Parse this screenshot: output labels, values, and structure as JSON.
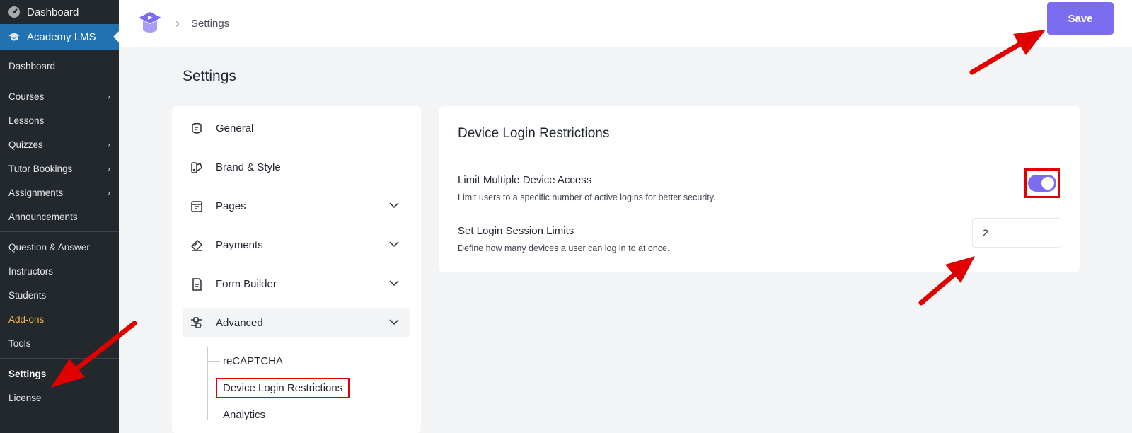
{
  "wp_sidebar": {
    "top_item": "Dashboard",
    "active_plugin": "Academy LMS",
    "items": [
      {
        "label": "Dashboard",
        "chevron": false
      },
      {
        "label": "Courses",
        "chevron": true
      },
      {
        "label": "Lessons",
        "chevron": false
      },
      {
        "label": "Quizzes",
        "chevron": true
      },
      {
        "label": "Tutor Bookings",
        "chevron": true
      },
      {
        "label": "Assignments",
        "chevron": true
      },
      {
        "label": "Announcements",
        "chevron": false
      },
      {
        "label": "Question & Answer",
        "chevron": false
      },
      {
        "label": "Instructors",
        "chevron": false
      },
      {
        "label": "Students",
        "chevron": false
      },
      {
        "label": "Add-ons",
        "chevron": false
      },
      {
        "label": "Tools",
        "chevron": false
      },
      {
        "label": "Settings",
        "chevron": false
      },
      {
        "label": "License",
        "chevron": false
      }
    ]
  },
  "header": {
    "breadcrumb": "Settings",
    "save_label": "Save"
  },
  "page_title": "Settings",
  "settings_menu": {
    "items": [
      {
        "label": "General",
        "icon": "general-icon"
      },
      {
        "label": "Brand & Style",
        "icon": "brand-style-icon"
      },
      {
        "label": "Pages",
        "icon": "pages-icon"
      },
      {
        "label": "Payments",
        "icon": "payments-icon"
      },
      {
        "label": "Form Builder",
        "icon": "form-builder-icon"
      },
      {
        "label": "Advanced",
        "icon": "advanced-icon"
      }
    ],
    "submenu": [
      "reCAPTCHA",
      "Device Login Restrictions",
      "Analytics"
    ]
  },
  "panel": {
    "title": "Device Login Restrictions",
    "limit_label": "Limit Multiple Device Access",
    "limit_desc": "Limit users to a specific number of active logins for better security.",
    "limit_enabled": true,
    "session_label": "Set Login Session Limits",
    "session_desc": "Define how many devices a user can log in to at once.",
    "session_value": "2"
  },
  "colors": {
    "accent": "#7c6cf0",
    "wp_sidebar": "#23282d",
    "wp_active": "#2271b1",
    "annotation": "#e00000"
  }
}
